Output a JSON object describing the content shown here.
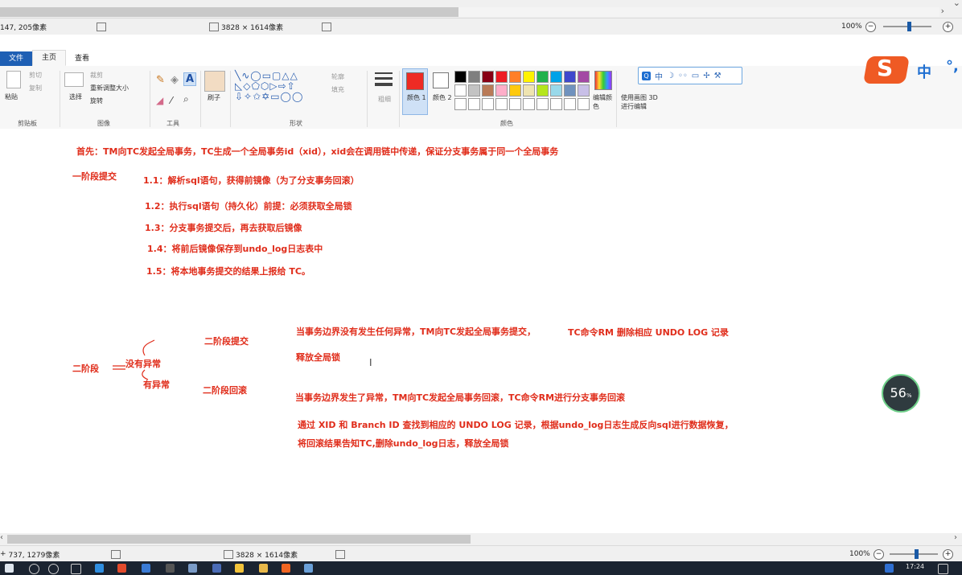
{
  "top_status": {
    "cursor_pos": "147, 205像素",
    "image_size": "3828 × 1614像素",
    "zoom": "100%"
  },
  "bottom_status": {
    "cursor_pos": "737, 1279像素",
    "image_size": "3828 × 1614像素",
    "zoom": "100%"
  },
  "ribbon": {
    "tabs": [
      "文件",
      "主页",
      "查看"
    ],
    "clipboard": {
      "paste": "粘贴",
      "cut": "剪切",
      "copy": "复制",
      "label": "剪贴板"
    },
    "image": {
      "select": "选择",
      "crop": "裁剪",
      "resize": "重新调整大小",
      "rotate": "旋转",
      "label": "图像"
    },
    "tools": {
      "label": "工具"
    },
    "brush": {
      "label": "刷子"
    },
    "shapes": {
      "outline": "轮廓",
      "fill": "填充",
      "label": "形状"
    },
    "size": {
      "label": "粗细"
    },
    "colors": {
      "color1": "颜色 1",
      "color2": "颜色 2",
      "edit": "编辑颜色",
      "label": "颜色"
    },
    "paint3d": "使用画图 3D 进行编辑",
    "palette_row1": [
      "#000000",
      "#7f7f7f",
      "#880015",
      "#ed1c24",
      "#ff7f27",
      "#fff200",
      "#22b14c",
      "#00a2e8",
      "#3f48cc",
      "#a349a4"
    ],
    "palette_row2": [
      "#ffffff",
      "#c3c3c3",
      "#b97a57",
      "#ffaec9",
      "#ffc90e",
      "#efe4b0",
      "#b5e61d",
      "#99d9ea",
      "#7092be",
      "#c8bfe7"
    ]
  },
  "ime": {
    "chinese": "中",
    "punct": "°,"
  },
  "notes": {
    "intro": "首先：TM向TC发起全局事务，TC生成一个全局事务id（xid），xid会在调用链中传递，保证分支事务属于同一个全局事务",
    "phase1_title": "一阶段提交",
    "step1": "1.1：解析sql语句，获得前镜像（为了分支事务回滚）",
    "step2": "1.2：执行sql语句（持久化）前提：必须获取全局锁",
    "step3": "1.3：分支事务提交后，再去获取后镜像",
    "step4": "1.4：将前后镜像保存到undo_log日志表中",
    "step5": "1.5：将本地事务提交的结果上报给 TC。",
    "phase2": "二阶段",
    "no_exception": "没有异常",
    "has_exception": "有异常",
    "commit_title": "二阶段提交",
    "rollback_title": "二阶段回滚",
    "commit_desc_a": "当事务边界没有发生任何异常，TM向TC发起全局事务提交，",
    "commit_desc_b": "TC命令RM  删除相应 UNDO LOG 记录",
    "commit_release": "释放全局锁",
    "rollback_desc": "当事务边界发生了异常，TM向TC发起全局事务回滚，TC命令RM进行分支事务回滚",
    "rollback_detail1": "通过 XID 和 Branch ID 查找到相应的 UNDO LOG 记录，根据undo_log日志生成反向sql进行数据恢复，",
    "rollback_detail2": "将回滚结果告知TC,删除undo_log日志，释放全局锁"
  },
  "badge": {
    "value": "56",
    "unit": "%"
  },
  "taskbar": {
    "time": "17:24"
  },
  "colors": {
    "accent": "#1e5fb4",
    "note_red": "#e02d1b"
  }
}
